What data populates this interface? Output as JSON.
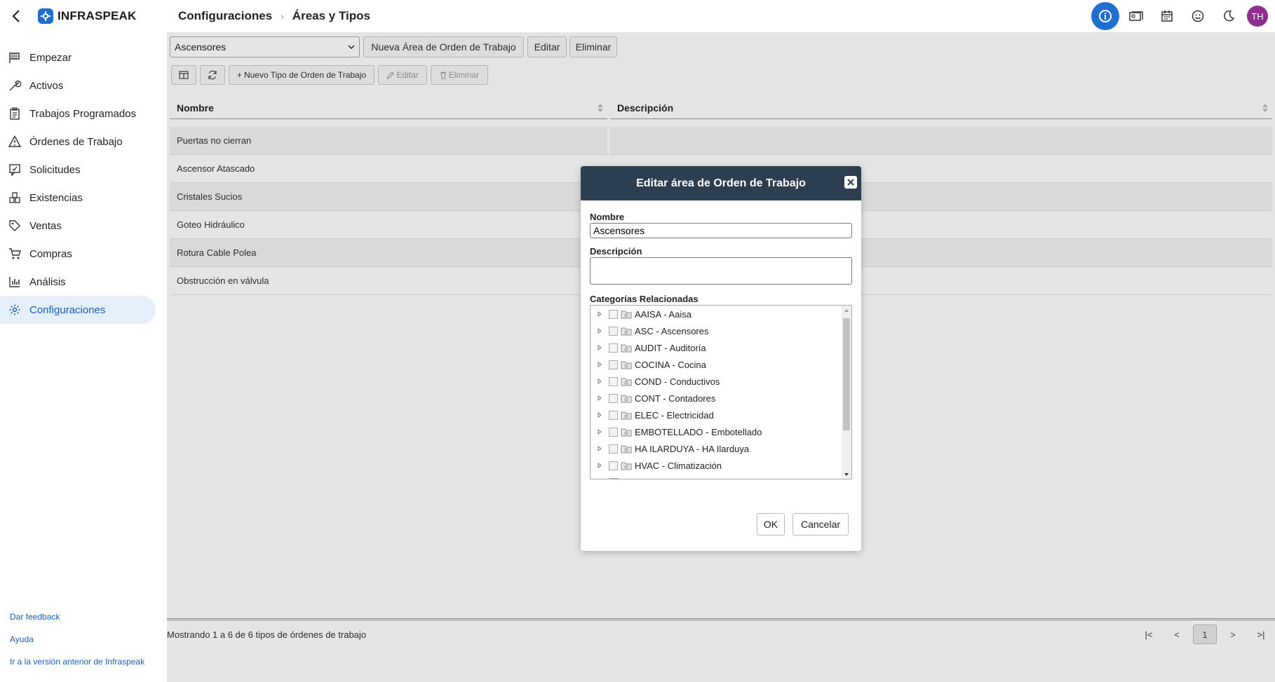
{
  "app": {
    "brand": "INFRASPEAK",
    "accent": "#1f6fd1"
  },
  "breadcrumb": {
    "parent": "Configuraciones",
    "current": "Áreas y Tipos"
  },
  "header": {
    "avatar_initials": "TH",
    "icons": [
      "info-icon",
      "account-card-icon",
      "calendar-icon",
      "smiley-icon",
      "moon-icon"
    ]
  },
  "sidebar": {
    "items": [
      {
        "label": "Empezar",
        "icon": "flag-icon"
      },
      {
        "label": "Activos",
        "icon": "wrench-icon"
      },
      {
        "label": "Trabajos Programados",
        "icon": "clipboard-icon"
      },
      {
        "label": "Órdenes de Trabajo",
        "icon": "warning-icon"
      },
      {
        "label": "Solicitudes",
        "icon": "request-icon"
      },
      {
        "label": "Existencias",
        "icon": "boxes-icon"
      },
      {
        "label": "Ventas",
        "icon": "tag-icon"
      },
      {
        "label": "Compras",
        "icon": "cart-icon"
      },
      {
        "label": "Análisis",
        "icon": "chart-icon"
      },
      {
        "label": "Configuraciones",
        "icon": "gear-icon"
      }
    ],
    "active": "Configuraciones",
    "links": [
      "Dar feedback",
      "Ayuda",
      "Ir a la versión anterior de Infraspeak"
    ]
  },
  "toolbar": {
    "area_select": "Ascensores",
    "new_area": "Nueva Área de Orden de Trabajo",
    "edit": "Editar",
    "delete": "Eliminar",
    "new_type": "Nuevo Tipo de Orden de Trabajo",
    "edit_type": "Editar",
    "delete_type": "Eliminar"
  },
  "table": {
    "columns": [
      "Nombre",
      "Descripción"
    ],
    "rows": [
      "Puertas no cierran",
      "Ascensor Atascado",
      "Cristales Sucios",
      "Goteo Hidráulico",
      "Rotura Cable Polea",
      "Obstrucción en válvula"
    ]
  },
  "footer": {
    "summary": "Mostrando 1 a 6 de 6 tipos de órdenes de trabajo",
    "pager": {
      "first": "|<",
      "prev": "<",
      "page": "1",
      "next": ">",
      "last": ">|"
    }
  },
  "modal": {
    "title": "Editar área de Orden de Trabajo",
    "name_label": "Nombre",
    "name_value": "Ascensores",
    "desc_label": "Descripción",
    "desc_value": "",
    "categories_label": "Categorías Relacionadas",
    "categories": [
      "AAISA - Aaisa",
      "ASC - Ascensores",
      "AUDIT - Auditoría",
      "COCINA - Cocina",
      "COND - Conductivos",
      "CONT - Contadores",
      "ELEC - Electricidad",
      "EMBOTELLADO - Embotellado",
      "HA ILARDUYA - HA Ilarduya",
      "HVAC - Climatización"
    ],
    "ok": "OK",
    "cancel": "Cancelar"
  }
}
